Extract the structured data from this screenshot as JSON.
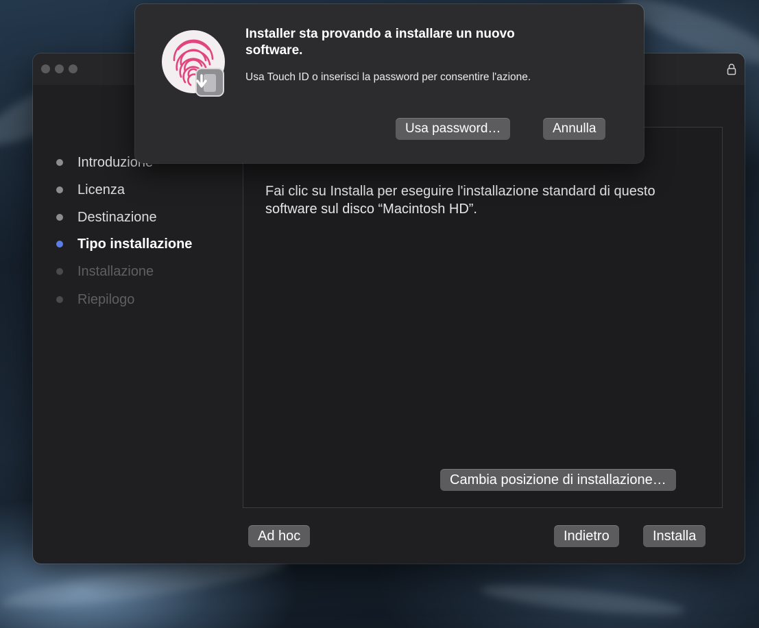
{
  "installer": {
    "steps": [
      {
        "label": "Introduzione",
        "state": "done"
      },
      {
        "label": "Licenza",
        "state": "done"
      },
      {
        "label": "Destinazione",
        "state": "done"
      },
      {
        "label": "Tipo installazione",
        "state": "active"
      },
      {
        "label": "Installazione",
        "state": "pending"
      },
      {
        "label": "Riepilogo",
        "state": "pending"
      }
    ],
    "content_text": "Fai clic su Installa per eseguire l'installazione standard di questo software sul disco “Macintosh HD”.",
    "change_location_button": "Cambia posizione di installazione…",
    "adhoc_button": "Ad hoc",
    "back_button": "Indietro",
    "install_button": "Installa",
    "title_icon": "lock-icon"
  },
  "auth_dialog": {
    "title": "Installer sta provando a installare un nuovo software.",
    "message": "Usa Touch ID o inserisci la password per consentire l'azione.",
    "use_password_button": "Usa password…",
    "cancel_button": "Annulla",
    "icon": "touch-id-fingerprint-icon"
  },
  "colors": {
    "active_step_dot": "#5a7de8",
    "fingerprint": "#e0457b",
    "window_background": "#1f1f21"
  }
}
